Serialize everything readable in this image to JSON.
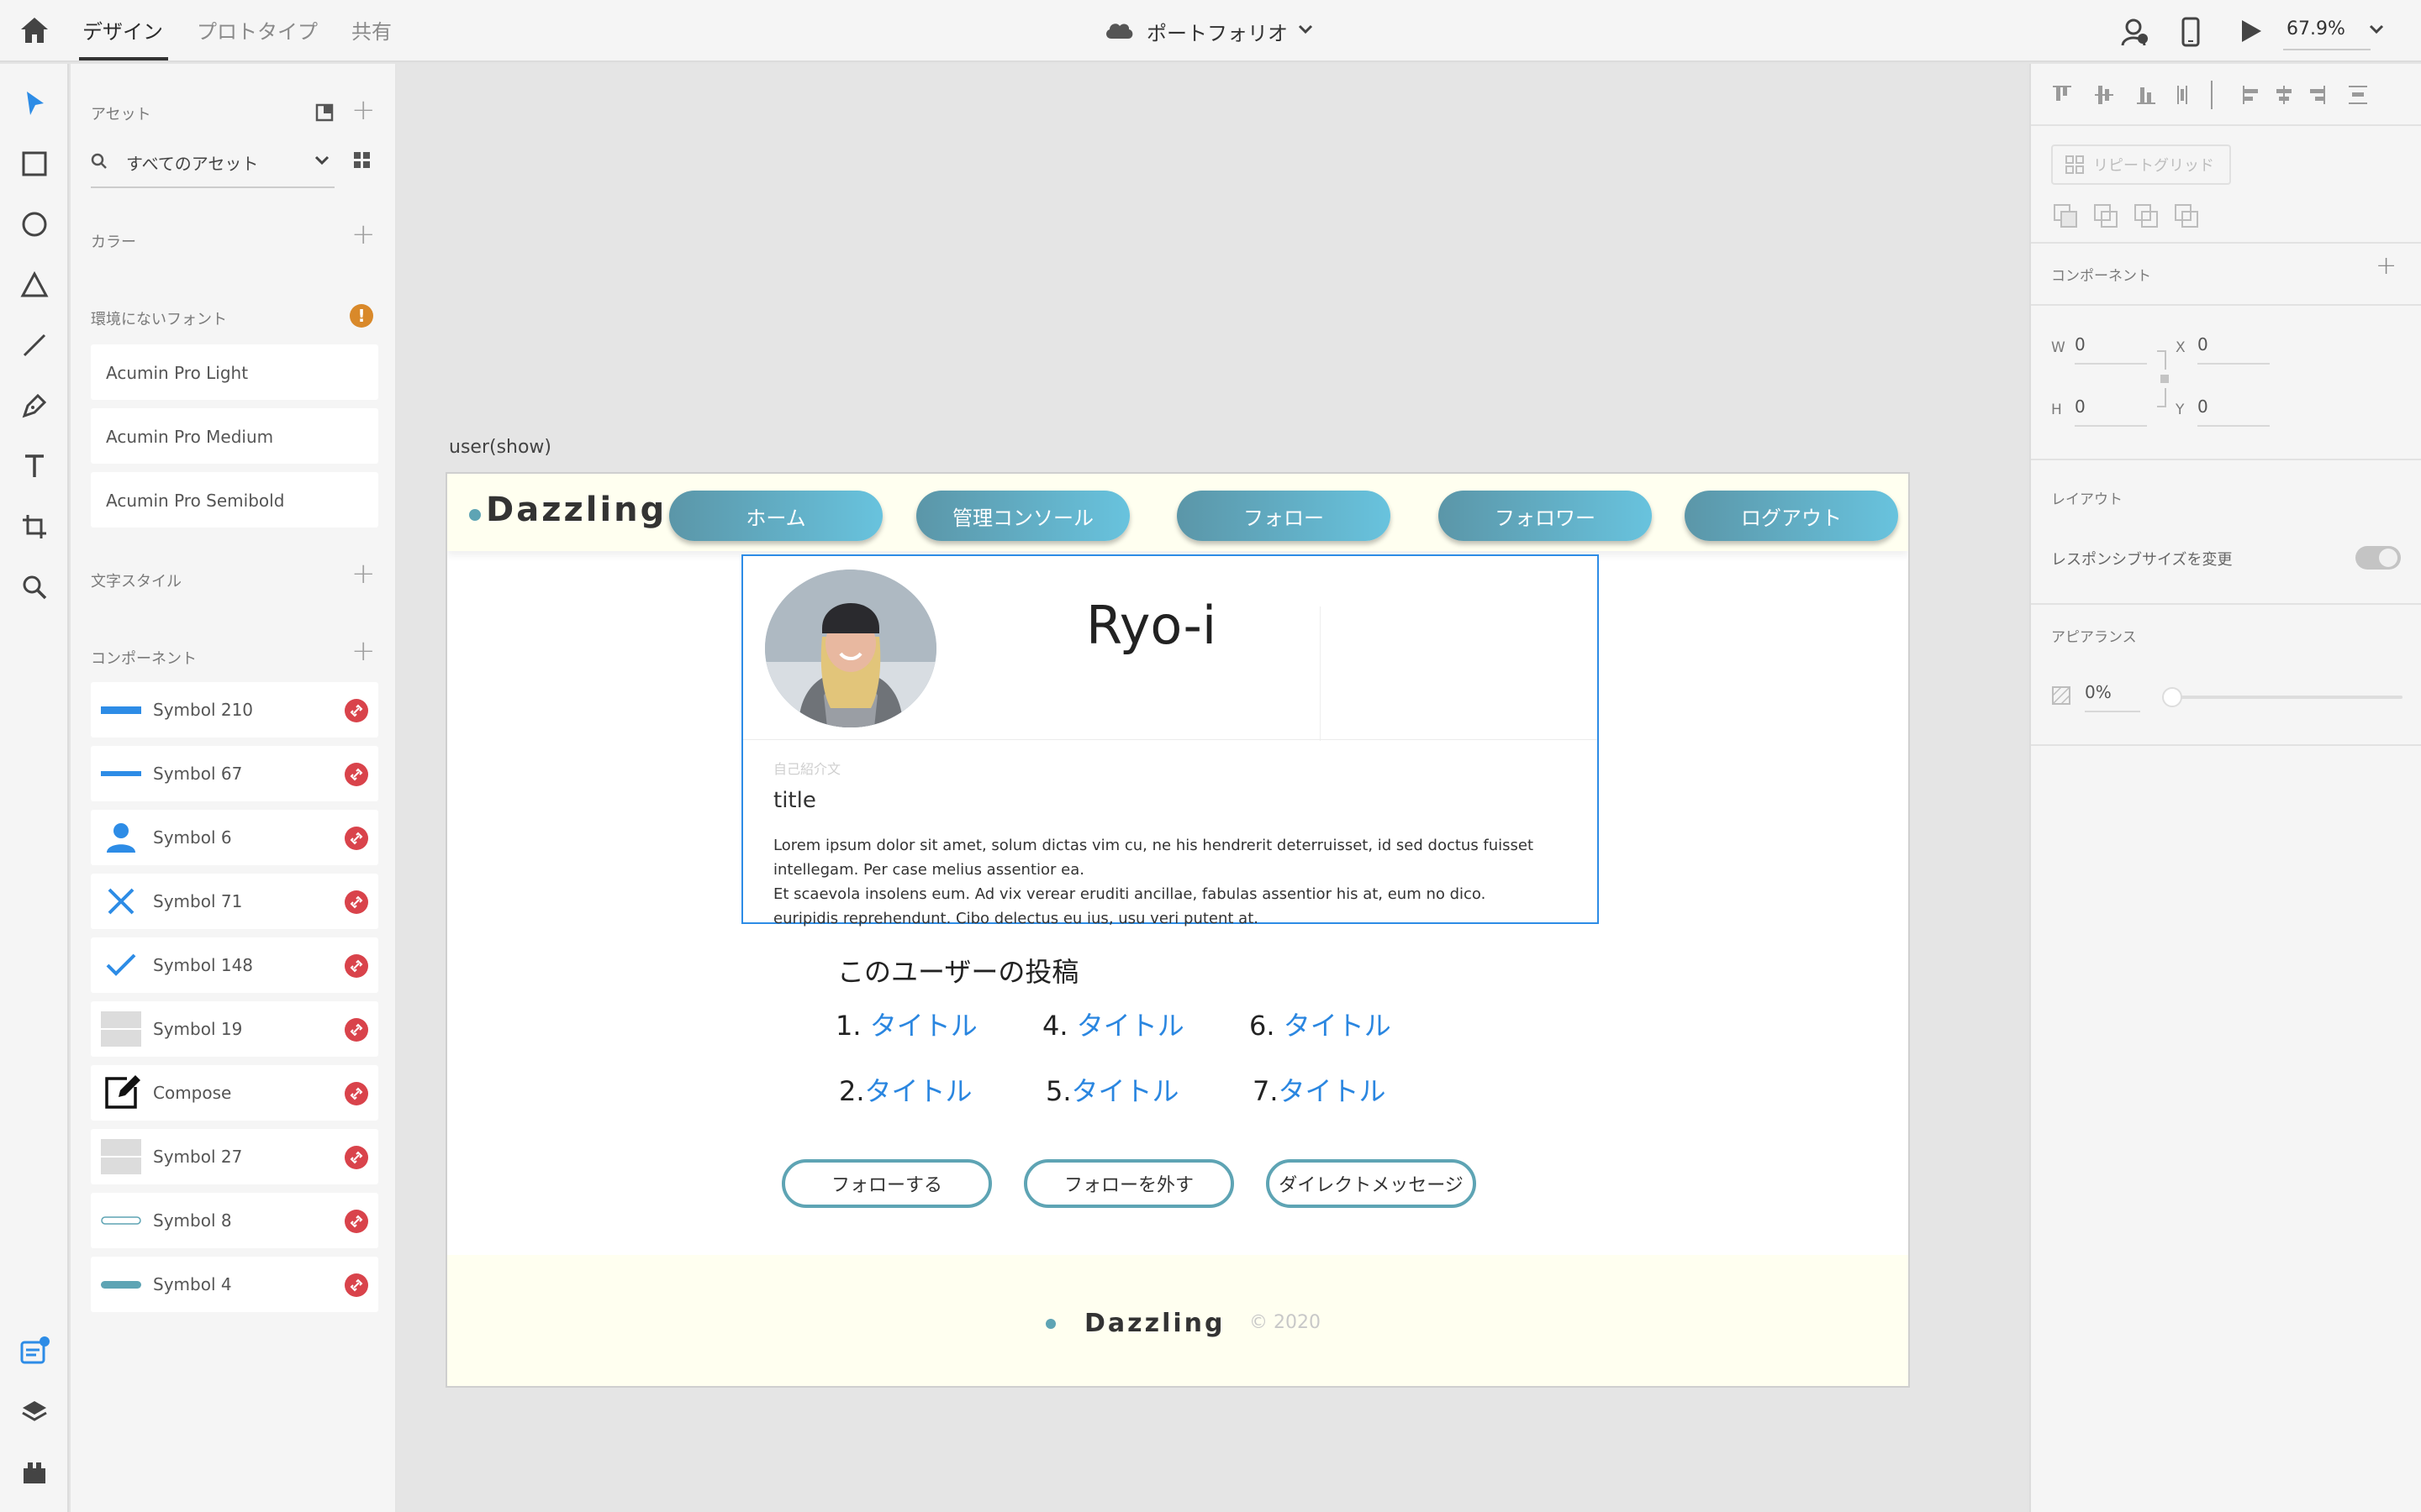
{
  "topbar": {
    "tabs": [
      {
        "label": "デザイン"
      },
      {
        "label": "プロトタイプ"
      },
      {
        "label": "共有"
      }
    ],
    "document_title": "ポートフォリオ",
    "zoom": "67.9%"
  },
  "assets": {
    "header": "アセット",
    "search_value": "すべてのアセット",
    "colors_label": "カラー",
    "missing_fonts_label": "環境にないフォント",
    "missing_fonts": [
      "Acumin Pro Light",
      "Acumin Pro Medium",
      "Acumin Pro Semibold"
    ],
    "text_styles_label": "文字スタイル",
    "components_label": "コンポーネント",
    "components": [
      {
        "label": "Symbol 210",
        "icon": "blue-bar-button-icon"
      },
      {
        "label": "Symbol 67",
        "icon": "blue-line-icon"
      },
      {
        "label": "Symbol 6",
        "icon": "person-icon"
      },
      {
        "label": "Symbol 71",
        "icon": "close-x-icon"
      },
      {
        "label": "Symbol 148",
        "icon": "checkmark-icon"
      },
      {
        "label": "Symbol 19",
        "icon": "gray-block-icon"
      },
      {
        "label": "Compose",
        "icon": "compose-icon"
      },
      {
        "label": "Symbol 27",
        "icon": "gray-block-icon"
      },
      {
        "label": "Symbol 8",
        "icon": "outline-pill-icon"
      },
      {
        "label": "Symbol 4",
        "icon": "teal-pill-icon"
      }
    ]
  },
  "artboard": {
    "name": "user(show)",
    "logo": "Dazzling",
    "nav": [
      "ホーム",
      "管理コンソール",
      "フォロー",
      "フォロワー",
      "ログアウト"
    ],
    "profile": {
      "username": "Ryo-i",
      "bio_label": "自己紹介文",
      "bio_title": "title",
      "bio_text": [
        "Lorem ipsum dolor sit amet, solum dictas vim cu, ne his hendrerit deterruisset, id sed doctus fuisset",
        "intellegam. Per case melius assentior ea.",
        "Et scaevola insolens eum. Ad vix verear eruditi ancillae, fabulas assentior his at, eum no dico.",
        "euripidis reprehendunt. Cibo delectus eu ius, usu veri putent at."
      ]
    },
    "posts_heading": "このユーザーの投稿",
    "posts_row1": [
      {
        "num": "1.",
        "title": "タイトル"
      },
      {
        "num": "4.",
        "title": "タイトル"
      },
      {
        "num": "6.",
        "title": "タイトル"
      }
    ],
    "posts_row2": [
      {
        "num": "2.",
        "title": "タイトル"
      },
      {
        "num": "5.",
        "title": "タイトル"
      },
      {
        "num": "7.",
        "title": "タイトル"
      }
    ],
    "buttons": [
      "フォローする",
      "フォローを外す",
      "ダイレクトメッセージ"
    ],
    "footer": {
      "logo": "Dazzling",
      "copyright": "© 2020"
    }
  },
  "props": {
    "repeat_grid": "リピートグリッド",
    "component_label": "コンポーネント",
    "w": "0",
    "h": "0",
    "x": "0",
    "y": "0",
    "w_label": "W",
    "h_label": "H",
    "x_label": "X",
    "y_label": "Y",
    "layout_label": "レイアウト",
    "responsive_label": "レスポンシブサイズを変更",
    "appearance_label": "アピアランス",
    "opacity": "0%"
  },
  "colors": {
    "accent_blue": "#2d8ce6",
    "nav_gradient_start": "#5b96a8",
    "nav_gradient_end": "#68c3de",
    "link_blue": "#2a86e0",
    "header_bg": "#fffff0",
    "warning_orange": "#d9892a",
    "link_badge_red": "#d9434b"
  }
}
